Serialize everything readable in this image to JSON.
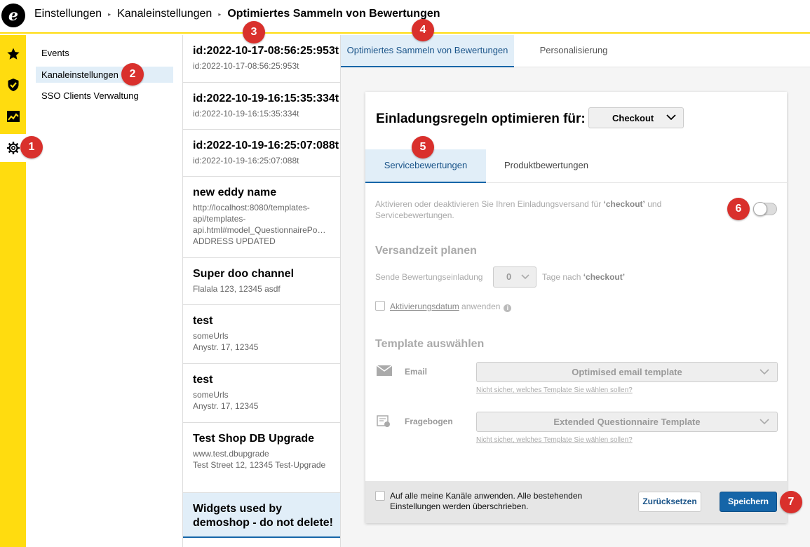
{
  "header": {
    "logo_letter": "e",
    "breadcrumbs": [
      "Einstellungen",
      "Kanaleinstellungen",
      "Optimiertes Sammeln von Bewertungen"
    ]
  },
  "rail": {
    "icons": [
      "star-icon",
      "shield-check-icon",
      "chart-icon",
      "gear-icon"
    ],
    "active": "gear-icon"
  },
  "subnav": {
    "items": [
      {
        "label": "Events"
      },
      {
        "label": "Kanaleinstellungen",
        "active": true
      },
      {
        "label": "SSO Clients Verwaltung"
      }
    ]
  },
  "channels": [
    {
      "title": "id:2022-10-17-08:56:25:953t",
      "sub": "id:2022-10-17-08:56:25:953t"
    },
    {
      "title": "id:2022-10-19-16:15:35:334t",
      "sub": "id:2022-10-19-16:15:35:334t"
    },
    {
      "title": "id:2022-10-19-16:25:07:088t",
      "sub": "id:2022-10-19-16:25:07:088t"
    },
    {
      "title": "new eddy name",
      "sub": "http://localhost:8080/templates-api/templates-api.html#model_QuestionnairePo…",
      "sub2": "ADDRESS UPDATED"
    },
    {
      "title": "Super doo channel",
      "sub": "Flalala 123, 12345 asdf"
    },
    {
      "title": "test",
      "sub": "someUrls",
      "sub2": "Anystr. 17, 12345"
    },
    {
      "title": "test",
      "sub": "someUrls",
      "sub2": "Anystr. 17, 12345"
    },
    {
      "title": "Test Shop DB Upgrade",
      "sub": "www.test.dbupgrade",
      "sub2": "Test Street 12, 12345 Test-Upgrade"
    },
    {
      "title": "Widgets used by demoshop - do not delete!",
      "active": true
    }
  ],
  "main": {
    "tabs": [
      {
        "label": "Optimiertes Sammeln von Bewertungen",
        "active": true
      },
      {
        "label": "Personalisierung"
      }
    ],
    "card": {
      "title": "Einladungsregeln optimieren für:",
      "trigger_select": "Checkout",
      "subtabs": [
        {
          "label": "Servicebewertungen",
          "active": true
        },
        {
          "label": "Produktbewertungen"
        }
      ],
      "toggle_desc_pre": "Aktivieren oder deaktivieren Sie Ihren Einladungsversand für ",
      "toggle_desc_bold": "‘checkout’",
      "toggle_desc_post": " und Servicebewertungen.",
      "toggle_on": false,
      "schedule_heading": "Versandzeit planen",
      "schedule_pre": "Sende Bewertungseinladung",
      "schedule_days": "0",
      "schedule_post_pre": "Tage nach ",
      "schedule_post_bold": "‘checkout’",
      "activation_link": "Aktivierungsdatum",
      "activation_post": " anwenden",
      "info_glyph": "i",
      "template_heading": "Template auswählen",
      "email_label": "Email",
      "email_template": "Optimised email template",
      "email_help": "Nicht sicher, welches Template Sie wählen sollen?",
      "questionnaire_label": "Fragebogen",
      "questionnaire_template": "Extended Questionnaire Template",
      "questionnaire_help": "Nicht sicher, welches Template Sie wählen sollen?",
      "footer_text": "Auf alle meine Kanäle anwenden. Alle bestehenden Einstellungen werden überschrieben.",
      "reset_label": "Zurücksetzen",
      "save_label": "Speichern"
    }
  },
  "markers": [
    "1",
    "2",
    "3",
    "4",
    "5",
    "6",
    "7"
  ],
  "colors": {
    "accent_yellow": "#ffdc0f",
    "primary_blue": "#1565a8",
    "marker_red": "#d9302c"
  }
}
